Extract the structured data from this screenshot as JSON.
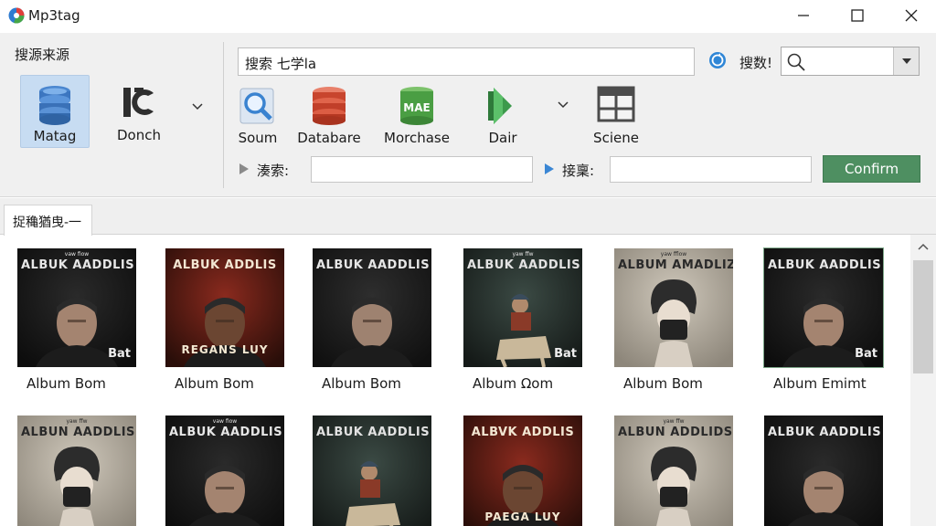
{
  "window": {
    "title": "Mp3tag",
    "minimize_icon": "minimize-icon",
    "maximize_icon": "maximize-icon",
    "close_icon": "close-icon"
  },
  "sources": {
    "label": "搜源来源",
    "items": [
      {
        "label": "Matag",
        "icon": "database-icon",
        "selected": true
      },
      {
        "label": "Donch",
        "icon": "ic-logo-icon",
        "selected": false
      }
    ]
  },
  "search": {
    "value": "搜索 七学la",
    "type_label": "搜数!",
    "combo_icon": "search-icon"
  },
  "tools": [
    {
      "label": "Soum",
      "icon": "magnifier-document-icon"
    },
    {
      "label": "Databare",
      "icon": "database-red-icon"
    },
    {
      "label": "Morchase",
      "icon": "green-database-icon",
      "icon_text": "MAE"
    },
    {
      "label": "Dair",
      "icon": "green-arrow-icon"
    },
    {
      "label": "Sciene",
      "icon": "window-grid-icon"
    }
  ],
  "fields": {
    "label1": "湊索:",
    "label2": "接稟:",
    "value1": "",
    "value2": "",
    "confirm": "Confirm"
  },
  "panel": {
    "tab_label": "捉穐猶曳-一"
  },
  "albums": [
    {
      "caption": "ALBUK AADDLIS",
      "kicker": "vaw fiow",
      "bottom": "Bat",
      "label": "Album Bom"
    },
    {
      "caption": "ALBUK ADDLIS",
      "kicker": "",
      "bottom": "REGANS LUY",
      "label": "Album Bom"
    },
    {
      "caption": "ALBUK AADDLIS",
      "kicker": "",
      "bottom": "",
      "label": "Album Bom"
    },
    {
      "caption": "ALBUK AADDLIS",
      "kicker": "yaw ffw",
      "bottom": "Bat",
      "label": "Album Ωom"
    },
    {
      "caption": "ALBUM AMADLIZS",
      "kicker": "yaw fflow",
      "bottom": "",
      "label": "Album Bom"
    },
    {
      "caption": "ALBUK AADDLIS",
      "kicker": "",
      "bottom": "Bat",
      "label": "Album Emimt"
    },
    {
      "caption": "ALBUN AADDLIS",
      "kicker": "yaw ffw",
      "bottom": "",
      "label": ""
    },
    {
      "caption": "ALBUK AADDLIS",
      "kicker": "vaw fiow",
      "bottom": "",
      "label": ""
    },
    {
      "caption": "ALBUK AADDLIS",
      "kicker": "",
      "bottom": "",
      "label": ""
    },
    {
      "caption": "ALBVK ADDLIS",
      "kicker": "",
      "bottom": "PAEGA LUY",
      "label": ""
    },
    {
      "caption": "ALBUN ADDLIDSS",
      "kicker": "yaw ffw",
      "bottom": "",
      "label": ""
    },
    {
      "caption": "ALBUK AADDLIS",
      "kicker": "",
      "bottom": "",
      "label": ""
    }
  ],
  "colors": {
    "accent_blue": "#c7dcf2",
    "confirm_green": "#4e8f61"
  }
}
